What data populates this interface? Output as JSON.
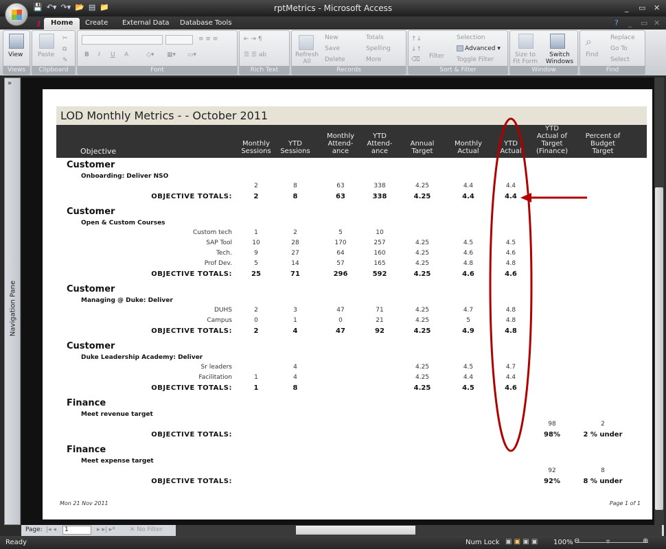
{
  "window": {
    "title": "rptMetrics - Microsoft Access"
  },
  "tabs": [
    "Home",
    "Create",
    "External Data",
    "Database Tools"
  ],
  "ribbon": {
    "views": {
      "label": "Views",
      "view": "View"
    },
    "clipboard": {
      "label": "Clipboard",
      "paste": "Paste"
    },
    "font": {
      "label": "Font",
      "bold": "B",
      "italic": "I",
      "underline": "U",
      "font_color": "A"
    },
    "rich_text": {
      "label": "Rich Text"
    },
    "records": {
      "label": "Records",
      "refresh": "Refresh All",
      "new": "New",
      "save": "Save",
      "delete": "Delete",
      "totals": "Totals",
      "spelling": "Spelling",
      "more": "More"
    },
    "sort_filter": {
      "label": "Sort & Filter",
      "filter": "Filter",
      "selection": "Selection",
      "advanced": "Advanced",
      "toggle_filter": "Toggle Filter"
    },
    "window": {
      "label": "Window",
      "size_to_fit": "Size to Fit Form",
      "switch_windows": "Switch Windows"
    },
    "find": {
      "label": "Find",
      "find": "Find",
      "replace": "Replace",
      "goto": "Go To",
      "select": "Select"
    }
  },
  "nav_pane": {
    "label": "Navigation Pane",
    "toggle": "»"
  },
  "report": {
    "title": "LOD Monthly Metrics - - October 2011",
    "columns": [
      "Objective",
      "Monthly\nSessions",
      "YTD\nSessions",
      "Monthly\nAttend-\nance",
      "YTD\nAttend-\nance",
      "Annual\nTarget",
      "Monthly\nActual",
      "YTD\nActual",
      "YTD\nActual of\nTarget\n(Finance)",
      "Percent of\nBudget\nTarget"
    ],
    "groups": [
      {
        "category": "Customer",
        "objective": "Onboarding: Deliver NSO",
        "rows": [
          {
            "label": "",
            "cells": [
              "2",
              "8",
              "63",
              "338",
              "4.25",
              "4.4",
              "4.4",
              "",
              ""
            ]
          }
        ],
        "totals": [
          "2",
          "8",
          "63",
          "338",
          "4.25",
          "4.4",
          "4.4",
          "",
          ""
        ]
      },
      {
        "category": "Customer",
        "objective": "Open & Custom Courses",
        "rows": [
          {
            "label": "Custom tech",
            "cells": [
              "1",
              "2",
              "5",
              "10",
              "",
              "",
              "",
              "",
              ""
            ]
          },
          {
            "label": "SAP Tool",
            "cells": [
              "10",
              "28",
              "170",
              "257",
              "4.25",
              "4.5",
              "4.5",
              "",
              ""
            ]
          },
          {
            "label": "Tech.",
            "cells": [
              "9",
              "27",
              "64",
              "160",
              "4.25",
              "4.6",
              "4.6",
              "",
              ""
            ]
          },
          {
            "label": "Prof Dev.",
            "cells": [
              "5",
              "14",
              "57",
              "165",
              "4.25",
              "4.8",
              "4.8",
              "",
              ""
            ]
          }
        ],
        "totals": [
          "25",
          "71",
          "296",
          "592",
          "4.25",
          "4.6",
          "4.6",
          "",
          ""
        ]
      },
      {
        "category": "Customer",
        "objective": "Managing @ Duke: Deliver",
        "rows": [
          {
            "label": "DUHS",
            "cells": [
              "2",
              "3",
              "47",
              "71",
              "4.25",
              "4.7",
              "4.8",
              "",
              ""
            ]
          },
          {
            "label": "Campus",
            "cells": [
              "0",
              "1",
              "0",
              "21",
              "4.25",
              "5",
              "4.8",
              "",
              ""
            ]
          }
        ],
        "totals": [
          "2",
          "4",
          "47",
          "92",
          "4.25",
          "4.9",
          "4.8",
          "",
          ""
        ]
      },
      {
        "category": "Customer",
        "objective": "Duke Leadership Academy: Deliver",
        "rows": [
          {
            "label": "Sr leaders",
            "cells": [
              "",
              "4",
              "",
              "",
              "4.25",
              "4.5",
              "4.7",
              "",
              ""
            ]
          },
          {
            "label": "Facilitation",
            "cells": [
              "1",
              "4",
              "",
              "",
              "4.25",
              "4.4",
              "4.4",
              "",
              ""
            ]
          }
        ],
        "totals": [
          "1",
          "8",
          "",
          "",
          "4.25",
          "4.5",
          "4.6",
          "",
          ""
        ]
      },
      {
        "category": "Finance",
        "objective": "Meet revenue target",
        "rows": [
          {
            "label": "",
            "cells": [
              "",
              "",
              "",
              "",
              "",
              "",
              "",
              "98",
              "2"
            ]
          }
        ],
        "totals": [
          "",
          "",
          "",
          "",
          "",
          "",
          "",
          "98%",
          "2 % under"
        ]
      },
      {
        "category": "Finance",
        "objective": "Meet expense target",
        "rows": [
          {
            "label": "",
            "cells": [
              "",
              "",
              "",
              "",
              "",
              "",
              "",
              "92",
              "8"
            ]
          }
        ],
        "totals": [
          "",
          "",
          "",
          "",
          "",
          "",
          "",
          "92%",
          "8 % under"
        ]
      }
    ],
    "totals_label": "OBJECTIVE TOTALS:",
    "footer_date": "Mon 21 Nov 2011",
    "footer_page": "Page 1 of 1"
  },
  "annotation_color": "#b00000",
  "record_nav": {
    "page_label": "Page:",
    "page_value": "1",
    "no_filter": "No Filter"
  },
  "status": {
    "ready": "Ready",
    "num_lock": "Num Lock",
    "zoom": "100%"
  }
}
